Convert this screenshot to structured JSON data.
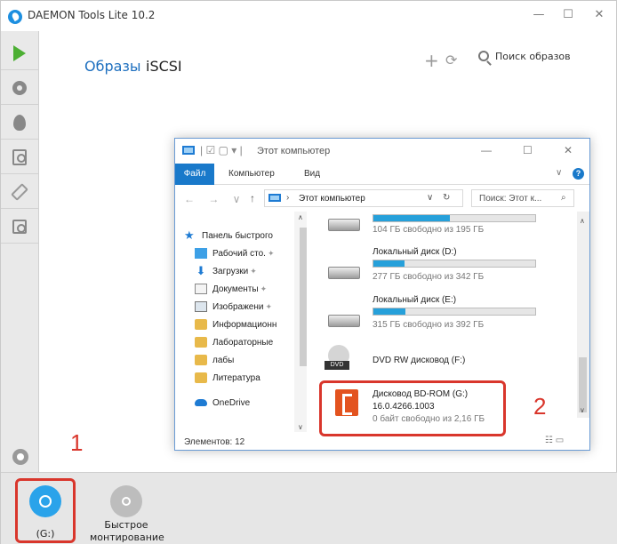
{
  "app": {
    "title": "DAEMON Tools Lite 10.2",
    "window_buttons": [
      "—",
      "☐",
      "✕"
    ],
    "tabs": [
      {
        "label": "Образы"
      },
      {
        "label": "iSCSI"
      }
    ],
    "toolbar": {
      "add": "+",
      "refresh": "⟳",
      "search_label": "Поиск образов"
    },
    "drives": [
      {
        "label": "(G:)"
      },
      {
        "label": "Быстрое монтирование"
      }
    ],
    "callouts": [
      "1",
      "2"
    ],
    "colors": {
      "accent": "#1d6fbf",
      "callout": "#d9362c",
      "disc_active": "#2aa3ea"
    }
  },
  "explorer": {
    "title": "Этот компьютер",
    "quick_icons": "| ☑ ▢ ▾ |",
    "window_buttons": [
      "—",
      "☐",
      "✕"
    ],
    "ribbon": {
      "file": "Файл",
      "computer": "Компьютер",
      "view": "Вид",
      "collapse": "∨",
      "help": "?"
    },
    "address": {
      "nav": "← → ∨",
      "up": "↑",
      "arrow": "›",
      "path": "Этот компьютер",
      "dropdown": "∨",
      "refresh": "↻"
    },
    "search_placeholder": "Поиск: Этот к...",
    "search_icon": "⌕",
    "nav_pane": [
      {
        "label": "Панель быстрого",
        "icon": "star-icon",
        "pinned": false
      },
      {
        "label": "Рабочий сто.",
        "icon": "desktop-icon",
        "pinned": true
      },
      {
        "label": "Загрузки",
        "icon": "download-icon",
        "pinned": true
      },
      {
        "label": "Документы",
        "icon": "documents-icon",
        "pinned": true
      },
      {
        "label": "Изображени",
        "icon": "pictures-icon",
        "pinned": true
      },
      {
        "label": "Информационн",
        "icon": "folder-icon",
        "pinned": false
      },
      {
        "label": "Лабораторные",
        "icon": "folder-icon",
        "pinned": false
      },
      {
        "label": "лабы",
        "icon": "folder-icon",
        "pinned": false
      },
      {
        "label": "Литература",
        "icon": "folder-icon",
        "pinned": false
      },
      {
        "label": "OneDrive",
        "icon": "onedrive-icon",
        "pinned": false
      }
    ],
    "pin_glyph": "✦",
    "drives": [
      {
        "name": "",
        "free": "104 ГБ свободно из 195 ГБ",
        "used_fraction": 0.47
      },
      {
        "name": "Локальный диск (D:)",
        "free": "277 ГБ свободно из 342 ГБ",
        "used_fraction": 0.19
      },
      {
        "name": "Локальный диск (E:)",
        "free": "315 ГБ свободно из 392 ГБ",
        "used_fraction": 0.2
      },
      {
        "name": "DVD RW дисковод (F:)",
        "badge": "DVD"
      },
      {
        "name": "Дисковод BD-ROM (G:)",
        "version": "16.0.4266.1003",
        "free": "0 байт свободно из 2,16 ГБ"
      }
    ],
    "status": "Элементов: 12",
    "view_icons": "☷ ▭",
    "scroll_up": "∧",
    "scroll_down": "∨"
  }
}
